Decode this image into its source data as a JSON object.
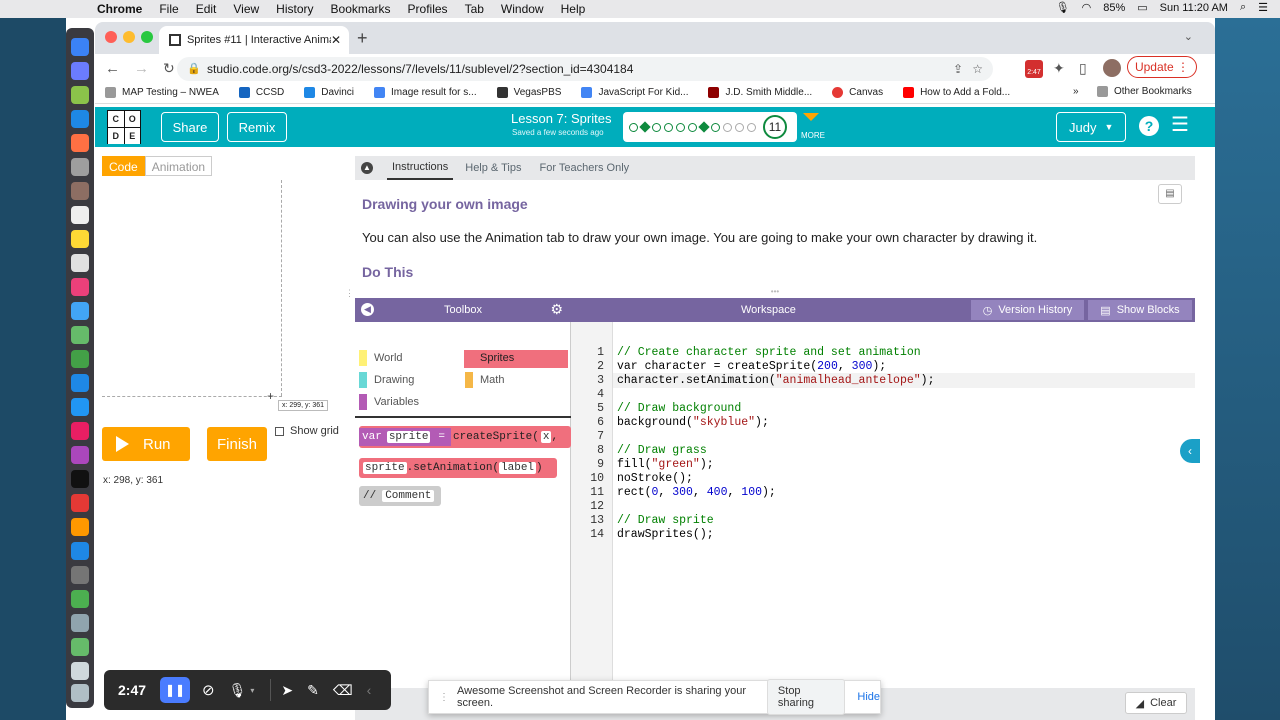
{
  "menubar": {
    "app": "Chrome",
    "items": [
      "File",
      "Edit",
      "View",
      "History",
      "Bookmarks",
      "Profiles",
      "Tab",
      "Window",
      "Help"
    ],
    "battery": "85%",
    "clock": "Sun 11:20 AM"
  },
  "browser": {
    "tab_title": "Sprites #11 | Interactive Animat",
    "url": "studio.code.org/s/csd3-2022/lessons/7/levels/11/sublevel/2?section_id=4304184",
    "update_label": "Update",
    "profile_badge": "2:47",
    "bookmarks": [
      "MAP Testing – NWEA",
      "CCSD",
      "Davinci",
      "Image result for s...",
      "VegasPBS",
      "JavaScript For Kid...",
      "J.D. Smith Middle...",
      "Canvas",
      "How to Add a Fold..."
    ],
    "other_bookmarks": "Other Bookmarks",
    "more_bookmarks": "»"
  },
  "header": {
    "logo_letters": [
      "C",
      "O",
      "D",
      "E"
    ],
    "share": "Share",
    "remix": "Remix",
    "lesson_title": "Lesson 7: Sprites",
    "saved": "Saved a few seconds ago",
    "level_number": "11",
    "more": "MORE",
    "user": "Judy"
  },
  "left": {
    "code_tab": "Code",
    "animation_tab": "Animation",
    "run": "Run",
    "finish": "Finish",
    "show_grid": "Show grid",
    "coords": "x: 298, y: 361",
    "cursor_tip": "x: 299, y: 361"
  },
  "instructions": {
    "tabs": [
      "Instructions",
      "Help & Tips",
      "For Teachers Only"
    ],
    "heading": "Drawing your own image",
    "body": "You can also use the Animation tab to draw your own image. You are going to make your own character by drawing it.",
    "do_this": "Do This"
  },
  "toolbox": {
    "title": "Toolbox",
    "categories": [
      {
        "label": "World",
        "color": "#fff176"
      },
      {
        "label": "Sprites",
        "color": "#f06f7d"
      },
      {
        "label": "Drawing",
        "color": "#68d8d6"
      },
      {
        "label": "Math",
        "color": "#f5b747"
      },
      {
        "label": "Variables",
        "color": "#b35bb5"
      }
    ],
    "blocks": [
      {
        "parts": [
          "var",
          "sprite",
          "=",
          "createSprite(",
          "x",
          ","
        ]
      },
      {
        "parts": [
          "sprite",
          ".setAnimation(",
          "label",
          ")"
        ]
      },
      {
        "parts": [
          "//",
          "Comment"
        ]
      }
    ]
  },
  "workspace": {
    "title": "Workspace",
    "version_history": "Version History",
    "show_blocks": "Show Blocks",
    "lines": [
      [
        {
          "t": "// Create character sprite and set animation",
          "c": "cmt"
        }
      ],
      [
        {
          "t": "var character = createSprite(",
          "c": ""
        },
        {
          "t": "200",
          "c": "num"
        },
        {
          "t": ", ",
          "c": ""
        },
        {
          "t": "300",
          "c": "num"
        },
        {
          "t": ");",
          "c": ""
        }
      ],
      [
        {
          "t": "character.setAnimation(",
          "c": ""
        },
        {
          "t": "\"animalhead_antelope\"",
          "c": "str"
        },
        {
          "t": ");",
          "c": ""
        }
      ],
      [],
      [
        {
          "t": "// Draw background",
          "c": "cmt"
        }
      ],
      [
        {
          "t": "background(",
          "c": ""
        },
        {
          "t": "\"skyblue\"",
          "c": "str"
        },
        {
          "t": ");",
          "c": ""
        }
      ],
      [],
      [
        {
          "t": "// Draw grass",
          "c": "cmt"
        }
      ],
      [
        {
          "t": "fill(",
          "c": ""
        },
        {
          "t": "\"green\"",
          "c": "str"
        },
        {
          "t": ");",
          "c": ""
        }
      ],
      [
        {
          "t": "noStroke();",
          "c": ""
        }
      ],
      [
        {
          "t": "rect(",
          "c": ""
        },
        {
          "t": "0",
          "c": "num"
        },
        {
          "t": ", ",
          "c": ""
        },
        {
          "t": "300",
          "c": "num"
        },
        {
          "t": ", ",
          "c": ""
        },
        {
          "t": "400",
          "c": "num"
        },
        {
          "t": ", ",
          "c": ""
        },
        {
          "t": "100",
          "c": "num"
        },
        {
          "t": ");",
          "c": ""
        }
      ],
      [],
      [
        {
          "t": "// Draw sprite",
          "c": "cmt"
        }
      ],
      [
        {
          "t": "drawSprites();",
          "c": ""
        }
      ]
    ],
    "clear": "Clear"
  },
  "recorder": {
    "time": "2:47"
  },
  "share_notice": {
    "text": "Awesome Screenshot and Screen Recorder is sharing your screen.",
    "stop": "Stop sharing",
    "hide": "Hide"
  },
  "colors": {
    "header": "#00adbc",
    "toolbox_purple": "#7665a0",
    "run_orange": "#ffa400"
  }
}
